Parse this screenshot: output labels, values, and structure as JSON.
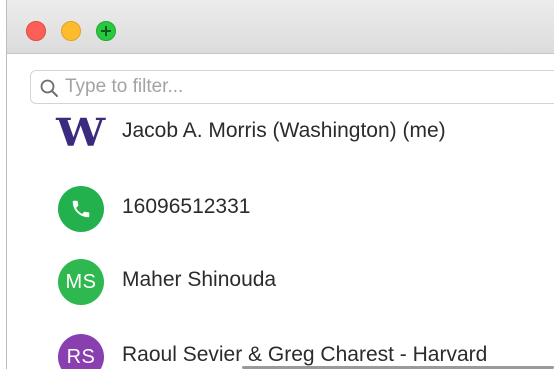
{
  "window": {
    "controls": [
      "close-button",
      "minimize-button",
      "zoom-button"
    ]
  },
  "search": {
    "placeholder": "Type to filter..."
  },
  "contacts": [
    {
      "name": "Jacob A. Morris (Washington) (me)",
      "avatar_type": "logo",
      "avatar_text": "W",
      "color": "#3b2a7d"
    },
    {
      "name": "16096512331",
      "avatar_type": "phone-icon",
      "avatar_text": "",
      "color": "#22b14c"
    },
    {
      "name": "Maher Shinouda",
      "avatar_type": "initials",
      "avatar_text": "MS",
      "color": "#2eb84f"
    },
    {
      "name": "Raoul Sevier & Greg Charest - Harvard",
      "avatar_type": "initials",
      "avatar_text": "RS",
      "color": "#8a3fb0"
    }
  ],
  "colors": {
    "close": "#fc5f57",
    "minimize": "#fdbc2e",
    "zoom": "#28c840",
    "titlebar": "#e3e3e3"
  }
}
